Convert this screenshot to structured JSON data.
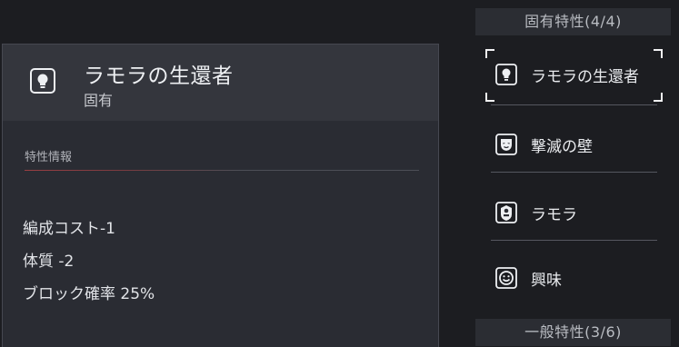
{
  "unique_traits_header": "固有特性(4/4)",
  "general_traits_header": "一般特性(3/6)",
  "detail": {
    "title": "ラモラの生還者",
    "category": "固有",
    "section_label": "特性情報",
    "effects": [
      "編成コスト-1",
      "体質 -2",
      "ブロック確率 25%"
    ],
    "icon": "lightbulb-icon"
  },
  "traits": [
    {
      "label": "ラモラの生還者",
      "icon": "lightbulb-icon",
      "selected": true
    },
    {
      "label": "撃滅の壁",
      "icon": "mask-icon",
      "selected": false
    },
    {
      "label": "ラモラ",
      "icon": "faction-badge-icon",
      "selected": false
    },
    {
      "label": "興味",
      "icon": "smiley-icon",
      "selected": false
    }
  ],
  "colors": {
    "background": "#1c1d21",
    "panel": "#2a2c33",
    "panel_header": "#34363d",
    "accent_line": "#9a3f43",
    "selection_corners": "#f1f1f3"
  }
}
